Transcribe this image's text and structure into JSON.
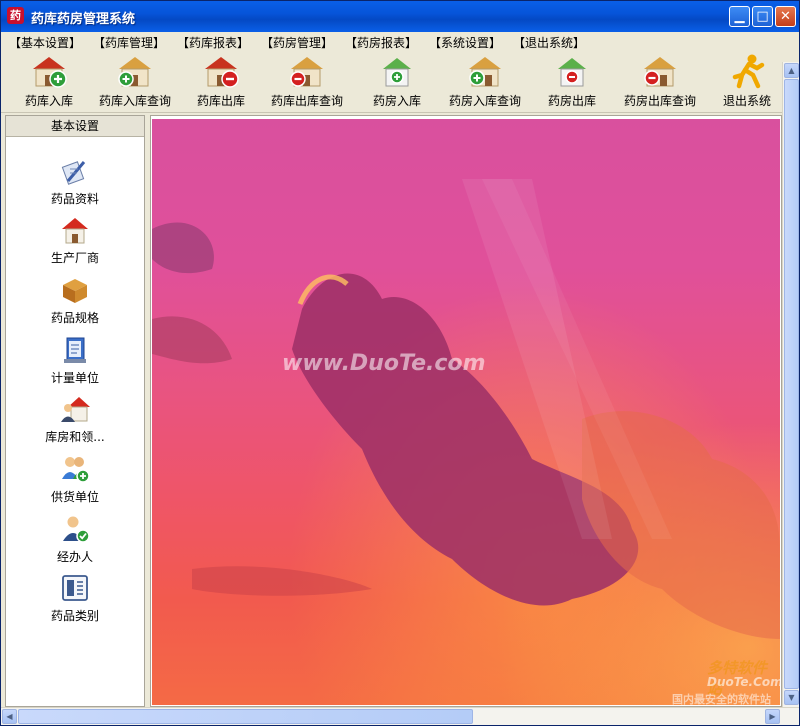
{
  "window": {
    "title": "药库药房管理系统",
    "app_icon": "药"
  },
  "menu": [
    "【基本设置】",
    "【药库管理】",
    "【药库报表】",
    "【药房管理】",
    "【药房报表】",
    "【系统设置】",
    "【退出系统】"
  ],
  "toolbar": [
    {
      "label": "药库入库",
      "icon": "warehouse-add-icon"
    },
    {
      "label": "药库入库查询",
      "icon": "warehouse-add-query-icon"
    },
    {
      "label": "药库出库",
      "icon": "warehouse-remove-icon"
    },
    {
      "label": "药库出库查询",
      "icon": "warehouse-remove-query-icon"
    },
    {
      "label": "药房入库",
      "icon": "pharmacy-add-icon"
    },
    {
      "label": "药房入库查询",
      "icon": "pharmacy-add-query-icon"
    },
    {
      "label": "药房出库",
      "icon": "pharmacy-remove-icon"
    },
    {
      "label": "药房出库查询",
      "icon": "pharmacy-remove-query-icon"
    },
    {
      "label": "退出系统",
      "icon": "exit-running-man-icon"
    }
  ],
  "sidebar": {
    "header": "基本设置",
    "items": [
      {
        "label": "药品资料",
        "icon": "document-pen-icon"
      },
      {
        "label": "生产厂商",
        "icon": "house-icon"
      },
      {
        "label": "药品规格",
        "icon": "package-box-icon"
      },
      {
        "label": "计量单位",
        "icon": "ledger-book-icon"
      },
      {
        "label": "库房和领...",
        "icon": "house-person-icon"
      },
      {
        "label": "供货单位",
        "icon": "users-add-icon"
      },
      {
        "label": "经办人",
        "icon": "user-check-icon"
      },
      {
        "label": "药品类别",
        "icon": "category-card-icon"
      }
    ]
  },
  "colors": {
    "titlebar": "#0a5fe8",
    "chrome": "#ece9d8",
    "sky_top": "#d9509e",
    "sky_bottom": "#f46a45"
  },
  "watermarks": {
    "center": "www.DuoTe.com",
    "corner_title": "多特软件站",
    "corner_url": "DuoTe.Com",
    "corner_tagline": "国内最安全的软件站"
  }
}
